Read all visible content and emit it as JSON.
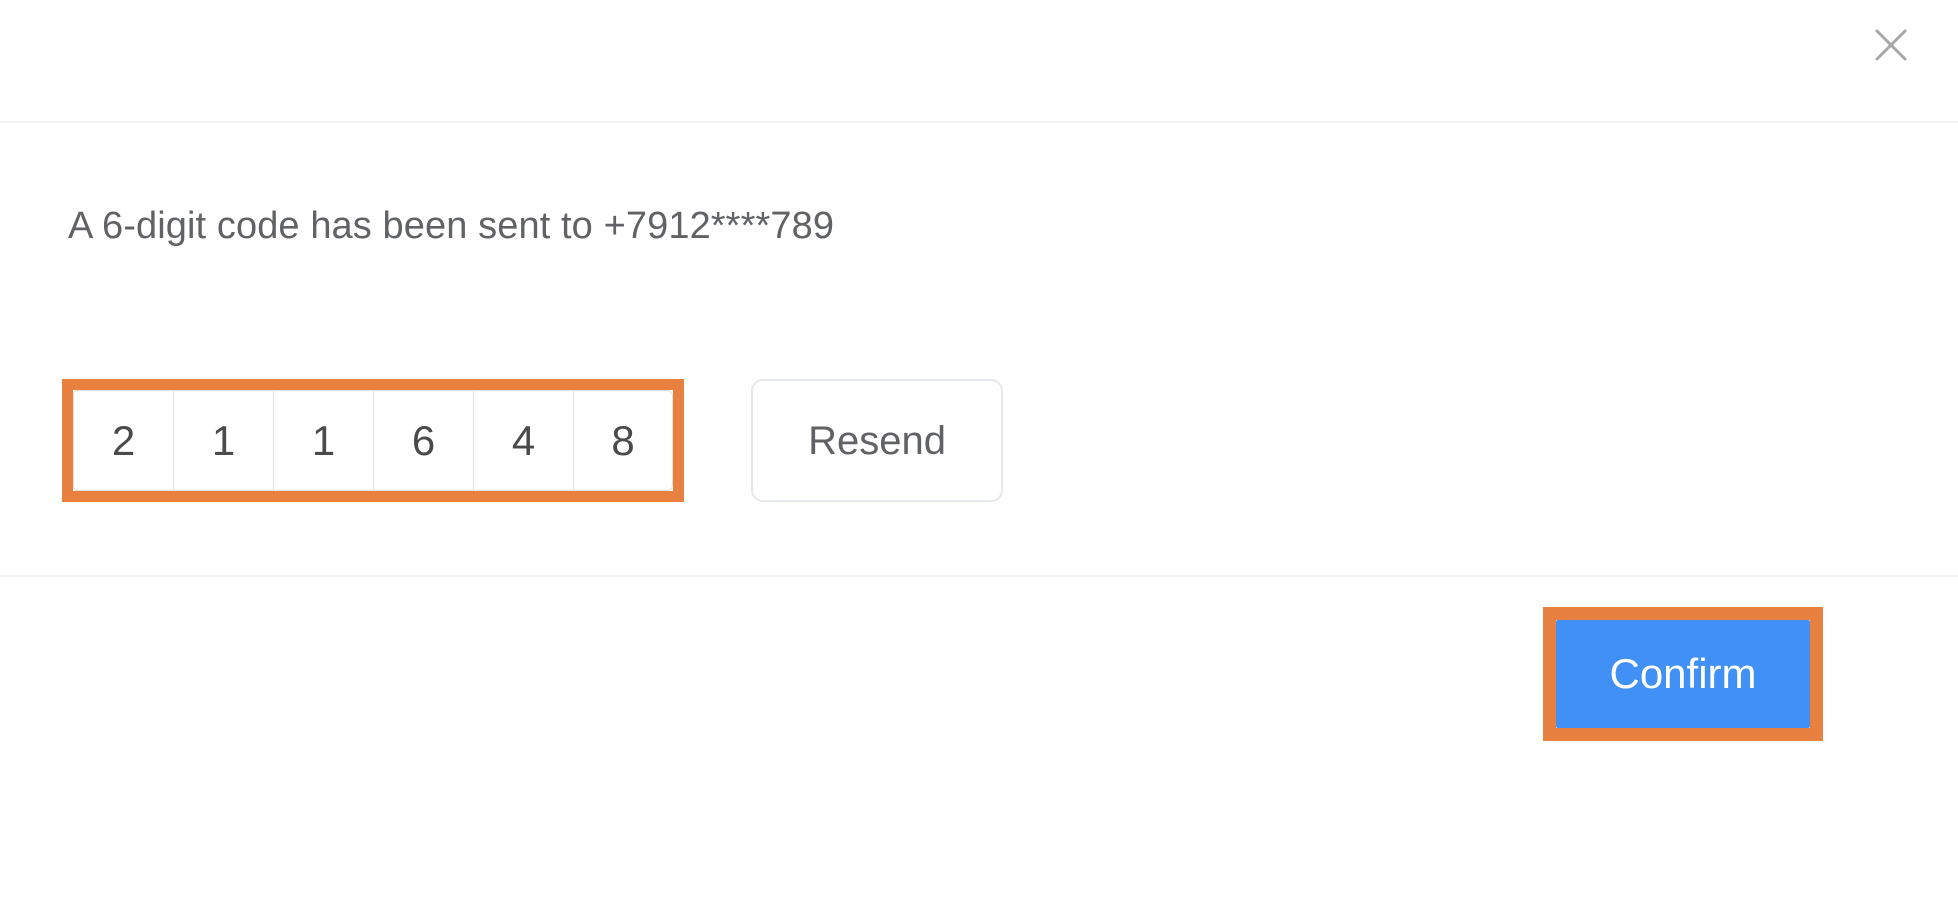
{
  "dialog": {
    "title": "",
    "close_icon": "close-icon",
    "message": "A 6-digit code has been sent to +7912****789",
    "phone_masked": "+7912****789",
    "code_length": 6,
    "otp_digits": [
      "2",
      "1",
      "1",
      "6",
      "4",
      "8"
    ],
    "otp_value": "211648",
    "otp_placeholder": "",
    "resend_label": "Resend",
    "confirm_label": "Confirm",
    "colors": {
      "accent_blue": "#4190f5",
      "highlight_orange": "#e8803f",
      "text_primary": "#606266",
      "text_digit": "#4a4a4a",
      "border_light": "#e4e7ed",
      "divider": "#f2f2f2"
    }
  }
}
